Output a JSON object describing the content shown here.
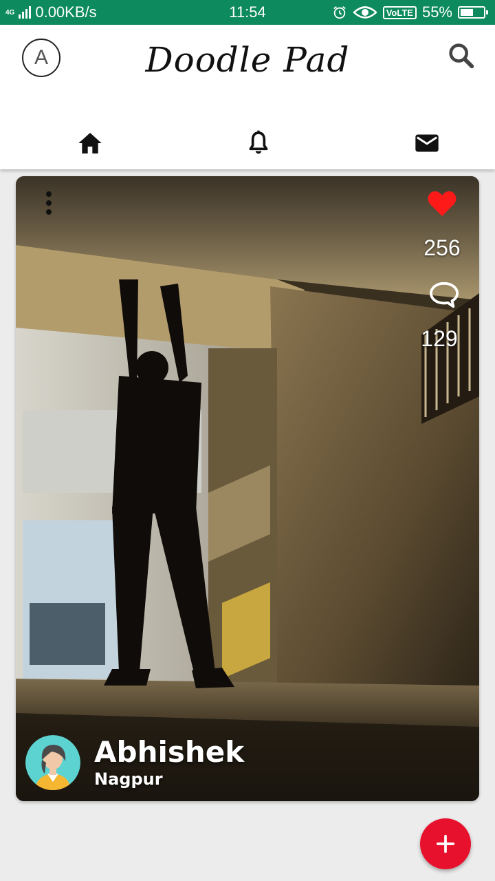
{
  "status_bar": {
    "network_type": "4G",
    "data_rate": "0.00KB/s",
    "time": "11:54",
    "volte": "VoLTE",
    "battery_percent": "55%",
    "battery_level": 0.55,
    "icons": [
      "signal-icon",
      "alarm-icon",
      "eye-icon",
      "battery-icon"
    ]
  },
  "header": {
    "profile_initial": "A",
    "app_title": "Doodle Pad",
    "search_icon": "search-icon"
  },
  "nav": {
    "items": [
      {
        "icon": "home-icon"
      },
      {
        "icon": "bell-icon"
      },
      {
        "icon": "mail-icon"
      }
    ]
  },
  "post": {
    "like_count": "256",
    "comment_count": "129",
    "like_color": "#ff1a1a",
    "user": {
      "name": "Abhishek",
      "location": "Nagpur"
    }
  },
  "fab": {
    "icon": "plus-icon",
    "color": "#e8112d"
  },
  "colors": {
    "status_bar": "#0d8a5e",
    "background": "#ececec"
  }
}
